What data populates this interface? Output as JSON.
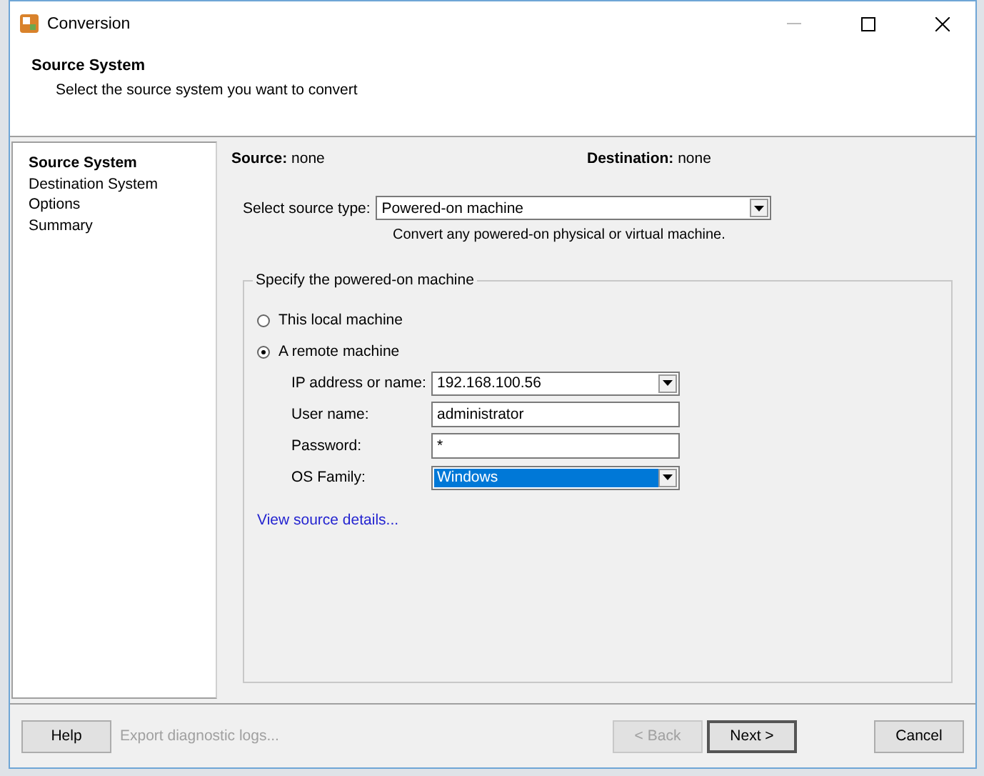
{
  "window": {
    "title": "Conversion"
  },
  "header": {
    "title": "Source System",
    "subtitle": "Select the source system you want to convert"
  },
  "steps": [
    {
      "label": "Source System",
      "selected": true
    },
    {
      "label": "Destination System",
      "selected": false
    },
    {
      "label": "Options",
      "selected": false
    },
    {
      "label": "Summary",
      "selected": false
    }
  ],
  "summary": [
    {
      "label": "Source:",
      "value": "none"
    },
    {
      "label": "Destination:",
      "value": "none"
    }
  ],
  "source_type": {
    "label": "Select source type:",
    "value": "Powered-on machine",
    "description": "Convert any powered-on physical or virtual machine."
  },
  "group": {
    "legend": "Specify the powered-on machine",
    "options": [
      {
        "label": "This local machine",
        "selected": false
      },
      {
        "label": "A remote machine",
        "selected": true
      }
    ],
    "fields": [
      {
        "label": "IP address or name:",
        "value": "192.168.100.56",
        "kind": "combo",
        "highlighted": false
      },
      {
        "label": "User name:",
        "value": "administrator",
        "kind": "text",
        "highlighted": false
      },
      {
        "label": "Password:",
        "value": "*",
        "kind": "text",
        "highlighted": false
      },
      {
        "label": "OS Family:",
        "value": "Windows",
        "kind": "combo",
        "highlighted": true
      }
    ],
    "link": "View source details..."
  },
  "footer": {
    "help": {
      "label": "Help",
      "disabled": false,
      "default": false
    },
    "export_link": {
      "label": "Export diagnostic logs...",
      "disabled": true
    },
    "buttons": [
      {
        "label": "< Back",
        "disabled": true,
        "default": false
      },
      {
        "label": "Next >",
        "disabled": false,
        "default": true
      }
    ],
    "cancel": {
      "label": "Cancel",
      "disabled": false,
      "default": false
    }
  }
}
